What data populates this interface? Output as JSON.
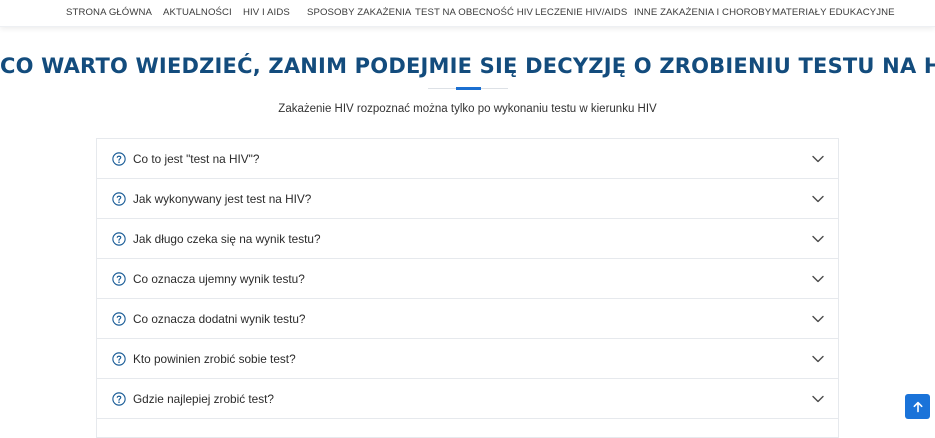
{
  "nav": {
    "items": [
      {
        "label": "STRONA GŁÓWNA"
      },
      {
        "label": "AKTUALNOŚCI"
      },
      {
        "label": "HIV I AIDS"
      },
      {
        "label": "SPOSOBY ZAKAŻENIA"
      },
      {
        "label": "TEST NA OBECNOŚĆ HIV"
      },
      {
        "label": "LECZENIE HIV/AIDS"
      },
      {
        "label": "INNE ZAKAŻENIA I CHOROBY"
      },
      {
        "label": "MATERIAŁY EDUKACYJNE"
      }
    ]
  },
  "page": {
    "heading": "CO WARTO WIEDZIEĆ, ZANIM PODEJMIE SIĘ DECYZJĘ O ZROBIENIU TESTU NA HIV?",
    "subheading": "Zakażenie HIV rozpoznać można tylko po wykonaniu testu w kierunku HIV"
  },
  "faq": {
    "items": [
      {
        "question": "Co to jest \"test na HIV\"?"
      },
      {
        "question": "Jak wykonywany jest test na HIV?"
      },
      {
        "question": "Jak długo czeka się na wynik testu?"
      },
      {
        "question": "Co oznacza ujemny wynik testu?"
      },
      {
        "question": "Co oznacza dodatni wynik testu?"
      },
      {
        "question": "Kto powinien zrobić sobie test?"
      },
      {
        "question": "Gdzie najlepiej zrobić test?"
      }
    ]
  },
  "icons": {
    "question": "question-circle-icon",
    "chevron": "chevron-down-icon",
    "scroll_top": "arrow-up-icon"
  },
  "colors": {
    "heading": "#134c7d",
    "accent": "#1b6fd1",
    "icon": "#1c5e98",
    "chevron": "#4a4a4a",
    "scroll_button": "#1a73d9"
  }
}
